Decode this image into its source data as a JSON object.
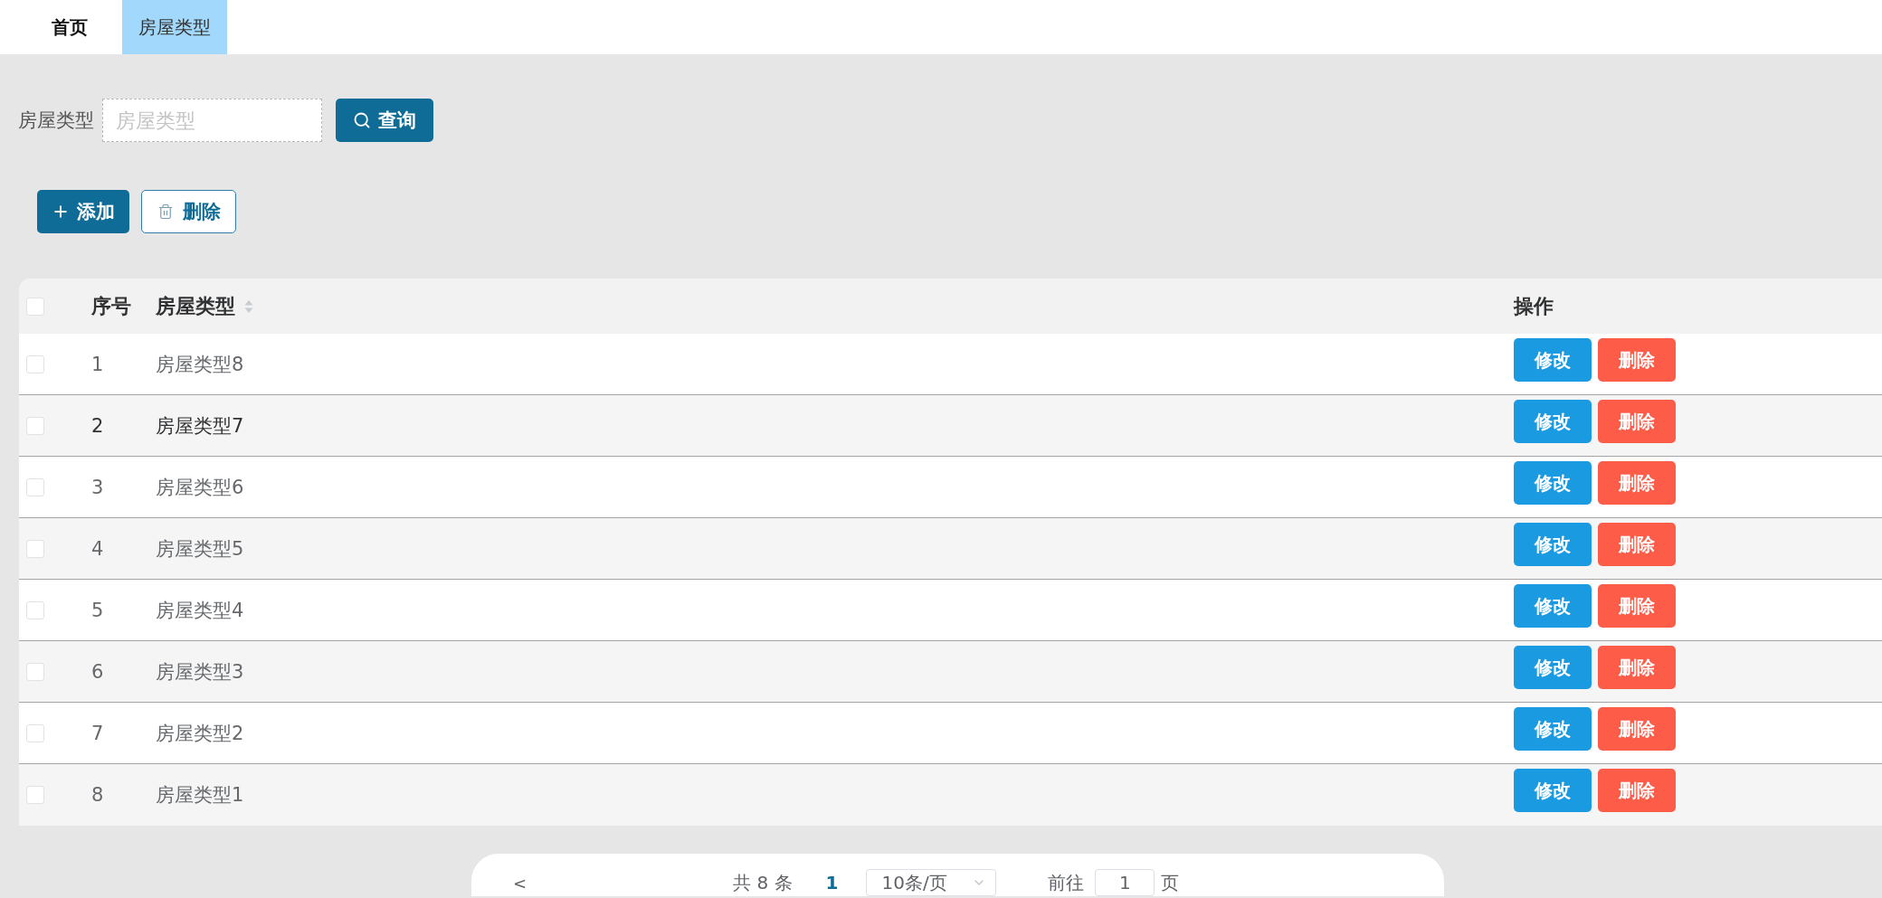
{
  "tabs": [
    {
      "label": "首页",
      "selected": false
    },
    {
      "label": "房屋类型",
      "selected": true
    }
  ],
  "search": {
    "label": "房屋类型",
    "placeholder": "房屋类型",
    "button": "查询"
  },
  "toolbar": [
    {
      "kind": "primary",
      "label": "添加"
    },
    {
      "kind": "outline",
      "label": "删除"
    }
  ],
  "table": {
    "select_all": {
      "checked": false
    },
    "columns": [
      {
        "label": "序号",
        "sortable": false
      },
      {
        "label": "房屋类型",
        "sortable": true
      },
      {
        "label": "操作",
        "sortable": false
      }
    ],
    "rows": [
      {
        "index": "1",
        "name": "房屋类型8",
        "checked": false,
        "hovered": false,
        "actions": [
          {
            "kind": "edit",
            "label": "修改"
          },
          {
            "kind": "delete",
            "label": "删除"
          }
        ]
      },
      {
        "index": "2",
        "name": "房屋类型7",
        "checked": false,
        "hovered": true,
        "actions": [
          {
            "kind": "edit",
            "label": "修改"
          },
          {
            "kind": "delete",
            "label": "删除"
          }
        ]
      },
      {
        "index": "3",
        "name": "房屋类型6",
        "checked": false,
        "hovered": false,
        "actions": [
          {
            "kind": "edit",
            "label": "修改"
          },
          {
            "kind": "delete",
            "label": "删除"
          }
        ]
      },
      {
        "index": "4",
        "name": "房屋类型5",
        "checked": false,
        "hovered": false,
        "actions": [
          {
            "kind": "edit",
            "label": "修改"
          },
          {
            "kind": "delete",
            "label": "删除"
          }
        ]
      },
      {
        "index": "5",
        "name": "房屋类型4",
        "checked": false,
        "hovered": false,
        "actions": [
          {
            "kind": "edit",
            "label": "修改"
          },
          {
            "kind": "delete",
            "label": "删除"
          }
        ]
      },
      {
        "index": "6",
        "name": "房屋类型3",
        "checked": false,
        "hovered": false,
        "actions": [
          {
            "kind": "edit",
            "label": "修改"
          },
          {
            "kind": "delete",
            "label": "删除"
          }
        ]
      },
      {
        "index": "7",
        "name": "房屋类型2",
        "checked": false,
        "hovered": false,
        "actions": [
          {
            "kind": "edit",
            "label": "修改"
          },
          {
            "kind": "delete",
            "label": "删除"
          }
        ]
      },
      {
        "index": "8",
        "name": "房屋类型1",
        "checked": false,
        "hovered": false,
        "actions": [
          {
            "kind": "edit",
            "label": "修改"
          },
          {
            "kind": "delete",
            "label": "删除"
          }
        ]
      }
    ]
  },
  "pagination": {
    "prev": "<",
    "total": "共 8 条",
    "pages": [
      {
        "label": "1",
        "selected": true
      }
    ],
    "page_size": "10条/页",
    "goto_label": "前往",
    "goto_value": "1",
    "goto_suffix": "页"
  }
}
